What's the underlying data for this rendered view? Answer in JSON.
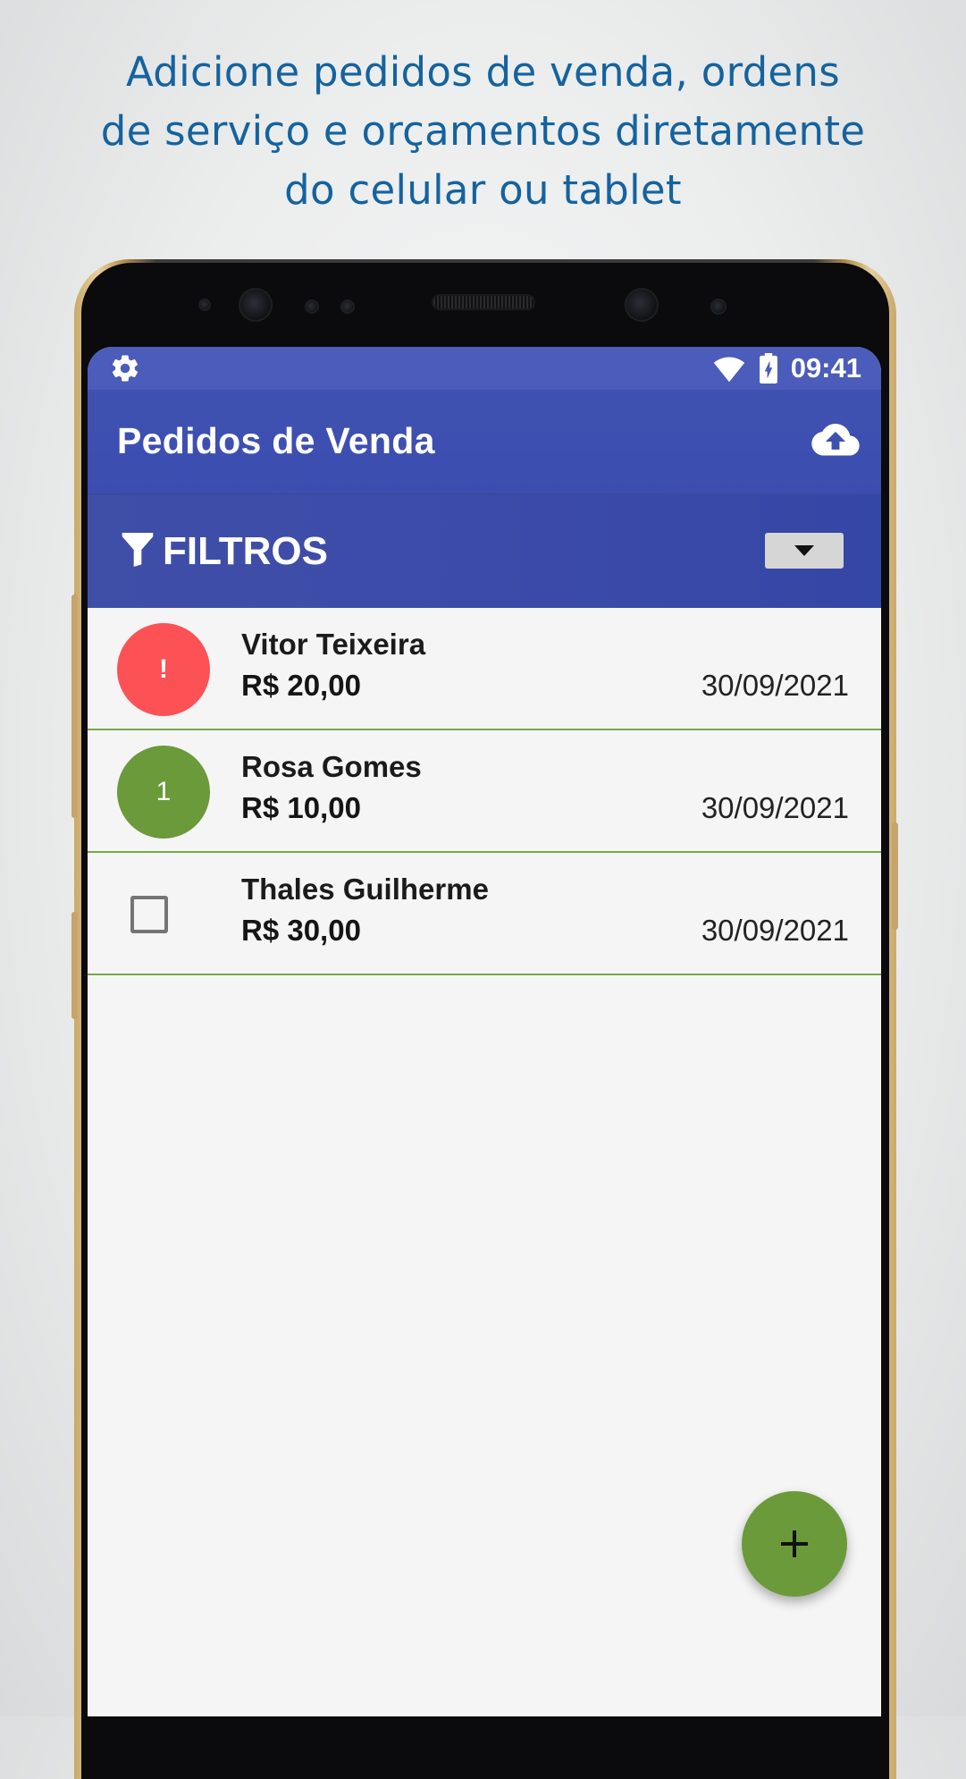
{
  "headline": {
    "lines": [
      "Adicione pedidos de venda, ordens",
      "de serviço e orçamentos diretamente",
      "do celular ou tablet"
    ]
  },
  "status_bar": {
    "time": "09:41",
    "icons": [
      "gear-icon",
      "wifi-icon",
      "battery-charging-icon"
    ]
  },
  "app_bar": {
    "title": "Pedidos de Venda",
    "action_icon": "cloud-upload-icon"
  },
  "filter_bar": {
    "label": "FILTROS",
    "icon": "filter-icon",
    "toggle_icon": "caret-down-icon"
  },
  "orders": [
    {
      "badge": "!",
      "badge_type": "alert",
      "badge_color": "#fc5255",
      "name": "Vitor Teixeira",
      "value": "R$ 20,00",
      "date": "30/09/2021"
    },
    {
      "badge": "1",
      "badge_type": "count",
      "badge_color": "#6b9a3a",
      "name": "Rosa Gomes",
      "value": "R$ 10,00",
      "date": "30/09/2021"
    },
    {
      "badge": "",
      "badge_type": "checkbox",
      "name": "Thales Guilherme",
      "value": "R$ 30,00",
      "date": "30/09/2021"
    }
  ],
  "fab": {
    "icon": "plus-icon",
    "color": "#6b9a3a"
  },
  "colors": {
    "headline": "#14639e",
    "app_bar": "#3f51b0",
    "status_bar": "#4b5cba",
    "divider": "#76a84b"
  }
}
